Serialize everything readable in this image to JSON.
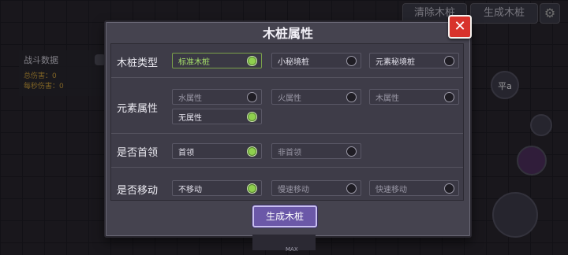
{
  "top_buttons": {
    "clear_label": "清除木桩",
    "generate_label": "生成木桩"
  },
  "battle_panel": {
    "title": "战斗数据",
    "total_damage": "总伤害：0",
    "dps": "每秒伤害：0"
  },
  "side": {
    "ping_label": "平a"
  },
  "dialog": {
    "title": "木桩属性",
    "rows": [
      {
        "label": "木桩类型",
        "options": [
          {
            "label": "标准木桩",
            "selected": true
          },
          {
            "label": "小秘境桩",
            "selected": false
          },
          {
            "label": "元素秘境桩",
            "selected": false
          }
        ]
      },
      {
        "label": "元素属性",
        "options": [
          {
            "label": "水属性",
            "selected": false
          },
          {
            "label": "火属性",
            "selected": false
          },
          {
            "label": "木属性",
            "selected": false
          },
          {
            "label": "无属性",
            "selected": true
          }
        ]
      },
      {
        "label": "是否首领",
        "options": [
          {
            "label": "首领",
            "selected": true
          },
          {
            "label": "非首领",
            "selected": false
          }
        ]
      },
      {
        "label": "是否移动",
        "options": [
          {
            "label": "不移动",
            "selected": true
          },
          {
            "label": "慢速移动",
            "selected": false
          },
          {
            "label": "快速移动",
            "selected": false
          }
        ]
      }
    ],
    "generate_label": "生成木桩",
    "close_icon": "close-icon"
  },
  "footer": {
    "max_label": "MAX"
  },
  "colors": {
    "accent_green": "#8fd04e",
    "close_red": "#d8322b",
    "button_purple": "#6b58a8"
  }
}
